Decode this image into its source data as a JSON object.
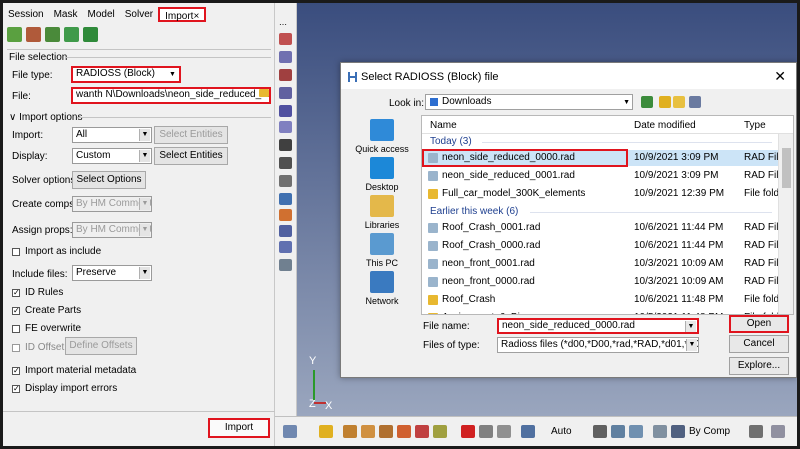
{
  "menu": {
    "tabs": [
      "Session",
      "Mask",
      "Model",
      "Solver",
      "Import"
    ],
    "active_tab": "Import",
    "close_glyph": "×"
  },
  "file_selection": {
    "section_title": "File selection",
    "file_type_label": "File type:",
    "file_type_value": "RADIOSS (Block)",
    "file_label": "File:",
    "file_value": "wanth N\\Downloads\\neon_side_reduced_0000.rad"
  },
  "import_options": {
    "section_title": "Import options",
    "import_label": "Import:",
    "import_value": "All",
    "select_entities_1": "Select Entities",
    "display_label": "Display:",
    "display_value": "Custom",
    "select_entities_2": "Select Entities",
    "solver_options_label": "Solver options:",
    "select_options": "Select Options",
    "create_comps_label": "Create comps:",
    "create_comps_value": "By HM Comments",
    "assign_props_label": "Assign props:",
    "assign_props_value": "By HM Comments",
    "import_as_include": "Import as include",
    "include_files_label": "Include files:",
    "include_files_value": "Preserve",
    "id_rules": "ID Rules",
    "create_parts": "Create Parts",
    "fe_overwrite": "FE overwrite",
    "id_offset": "ID Offset",
    "define_offsets": "Define Offsets",
    "import_material_metadata": "Import material metadata",
    "display_import_errors": "Display import errors",
    "checked": {
      "import_as_include": false,
      "id_rules": true,
      "create_parts": true,
      "fe_overwrite": false,
      "id_offset": false,
      "import_material_metadata": true,
      "display_import_errors": true
    }
  },
  "import_button": "Import",
  "viewport": {
    "axis_y": "Y",
    "axis_z": "Z",
    "axis_x": "X",
    "bottom_auto": "Auto",
    "bottom_bycomp": "By Comp"
  },
  "dialog": {
    "title": "Select RADIOSS (Block) file",
    "close": "✕",
    "look_in_label": "Look in:",
    "look_in_value": "Downloads",
    "places": [
      "Quick access",
      "Desktop",
      "Libraries",
      "This PC",
      "Network"
    ],
    "columns": [
      "Name",
      "Date modified",
      "Type"
    ],
    "groups": [
      {
        "title": "Today (3)",
        "rows": [
          {
            "name": "neon_side_reduced_0000.rad",
            "date": "10/9/2021 3:09 PM",
            "type": "RAD File",
            "kind": "file"
          },
          {
            "name": "neon_side_reduced_0001.rad",
            "date": "10/9/2021 3:09 PM",
            "type": "RAD File",
            "kind": "file"
          },
          {
            "name": "Full_car_model_300K_elements",
            "date": "10/9/2021 12:39 PM",
            "type": "File fold",
            "kind": "folder"
          }
        ]
      },
      {
        "title": "Earlier this week (6)",
        "rows": [
          {
            "name": "Roof_Crash_0001.rad",
            "date": "10/6/2021 11:44 PM",
            "type": "RAD File",
            "kind": "file"
          },
          {
            "name": "Roof_Crash_0000.rad",
            "date": "10/6/2021 11:44 PM",
            "type": "RAD File",
            "kind": "file"
          },
          {
            "name": "neon_front_0001.rad",
            "date": "10/3/2021 10:09 AM",
            "type": "RAD File",
            "kind": "file"
          },
          {
            "name": "neon_front_0000.rad",
            "date": "10/3/2021 10:09 AM",
            "type": "RAD File",
            "kind": "file"
          },
          {
            "name": "Roof_Crash",
            "date": "10/6/2021 11:48 PM",
            "type": "File fold",
            "kind": "folder"
          },
          {
            "name": "Assignment_6_Bic...",
            "date": "10/5/2021 11:48 PM",
            "type": "File fold",
            "kind": "folder"
          }
        ]
      }
    ],
    "file_name_label": "File name:",
    "file_name_value": "neon_side_reduced_0000.rad",
    "files_of_type_label": "Files of type:",
    "files_of_type_value": "Radioss files (*d00,*D00,*rad,*RAD,*d01,*D01,*.sta",
    "open_button": "Open",
    "cancel_button": "Cancel",
    "explore_button": "Explore..."
  },
  "colors": {
    "highlight_red": "#e0141e",
    "selection_blue": "#cce4f7",
    "viewport_top": "#3a4d7e",
    "viewport_bottom": "#9aa6be"
  }
}
